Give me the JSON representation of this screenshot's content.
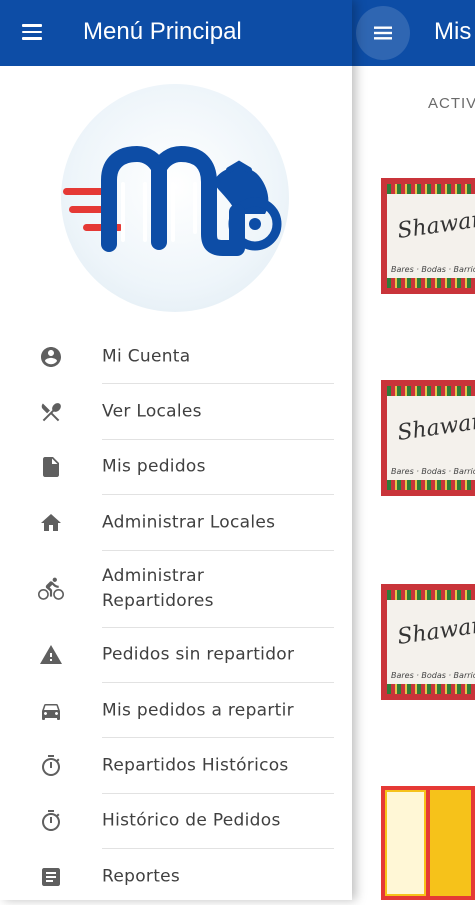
{
  "background_screen": {
    "title": "Mis",
    "tab_label": "ACTIV",
    "thumbnails": [
      {
        "script_text": "Shawarmaz",
        "caption": "Bares · Bodas · Barrio · Sucursal"
      },
      {
        "script_text": "Shawarmaz",
        "caption": "Bares · Bodas · Barrio · Sucursal"
      },
      {
        "script_text": "Shawarmaz",
        "caption": "Bares · Bodas · Barrio · Sucursal"
      }
    ]
  },
  "drawer": {
    "title": "Menú Principal",
    "menu_icon": "hamburger-menu-icon",
    "items": [
      {
        "label": "Mi Cuenta",
        "icon": "account-circle-icon"
      },
      {
        "label": "Ver Locales",
        "icon": "restaurant-icon"
      },
      {
        "label": "Mis pedidos",
        "icon": "document-icon"
      },
      {
        "label": "Administrar Locales",
        "icon": "home-icon"
      },
      {
        "label": "Administrar\nRepartidores",
        "icon": "bicycle-icon"
      },
      {
        "label": "Pedidos sin repartidor",
        "icon": "warning-icon"
      },
      {
        "label": "Mis pedidos a repartir",
        "icon": "car-icon"
      },
      {
        "label": "Repartidos Históricos",
        "icon": "timer-icon"
      },
      {
        "label": "Histórico de Pedidos",
        "icon": "timer-icon"
      },
      {
        "label": "Reportes",
        "icon": "report-icon"
      }
    ]
  },
  "colors": {
    "primary": "#0d4da6",
    "logo_red": "#e53935",
    "icon_gray": "#5f5f5f",
    "text_gray": "#404040"
  }
}
